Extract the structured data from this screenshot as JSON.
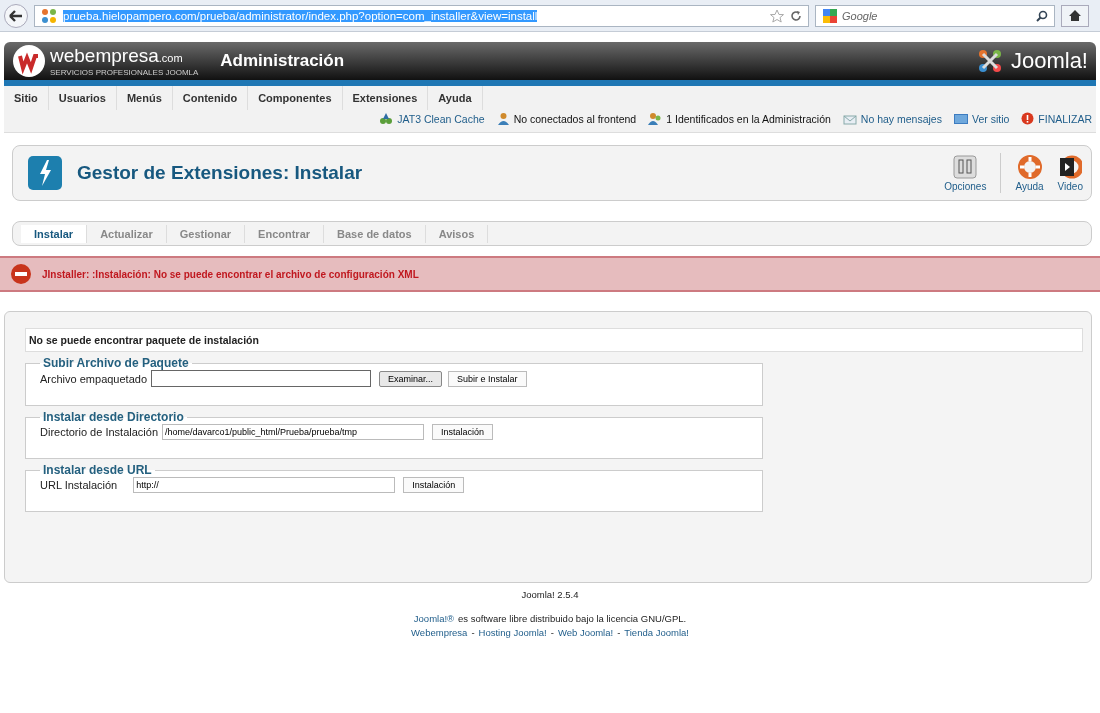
{
  "browser": {
    "url": "prueba.hielopampero.com/prueba/administrator/index.php?option=com_installer&view=install",
    "search_placeholder": "Google"
  },
  "header": {
    "brand": "webempresa",
    "brand_suffix": ".com",
    "tagline": "SERVICIOS PROFESIONALES JOOMLA",
    "title": "Administración",
    "logo": "Joomla!"
  },
  "menu": [
    "Sitio",
    "Usuarios",
    "Menús",
    "Contenido",
    "Componentes",
    "Extensiones",
    "Ayuda"
  ],
  "status": [
    {
      "label": "JAT3 Clean Cache",
      "kind": "cache"
    },
    {
      "label": "No conectados al frontend",
      "kind": "users"
    },
    {
      "label": "1 Identificados en la Administración",
      "kind": "admins"
    },
    {
      "label": "No hay mensajes",
      "kind": "messages"
    },
    {
      "label": "Ver sitio",
      "kind": "site"
    },
    {
      "label": "FINALIZAR",
      "kind": "logout"
    }
  ],
  "toolbar": {
    "title": "Gestor de Extensiones: Instalar",
    "buttons": [
      {
        "label": "Opciones",
        "kind": "options"
      },
      {
        "label": "Ayuda",
        "kind": "help"
      },
      {
        "label": "Video",
        "kind": "video"
      }
    ]
  },
  "subtabs": [
    {
      "label": "Instalar",
      "selected": true
    },
    {
      "label": "Actualizar",
      "selected": false
    },
    {
      "label": "Gestionar",
      "selected": false
    },
    {
      "label": "Encontrar",
      "selected": false
    },
    {
      "label": "Base de datos",
      "selected": false
    },
    {
      "label": "Avisos",
      "selected": false
    }
  ],
  "error": "JInstaller: :Instalación: No se puede encontrar el archivo de configuración XML",
  "notice": "No se puede encontrar paquete de instalación",
  "sections": [
    {
      "legend": "Subir Archivo de Paquete",
      "label": "Archivo empaquetado",
      "kind": "file",
      "buttons": [
        "Examinar...",
        "Subir e Instalar"
      ]
    },
    {
      "legend": "Instalar desde Directorio",
      "label": "Directorio de Instalación",
      "kind": "text",
      "value": "/home/davarco1/public_html/Prueba/prueba/tmp",
      "buttons": [
        "Instalación"
      ]
    },
    {
      "legend": "Instalar desde URL",
      "label": "URL Instalación",
      "kind": "text",
      "value": "http://",
      "buttons": [
        "Instalación"
      ]
    }
  ],
  "footer": {
    "version": "Joomla! 2.5.4",
    "license_link": "Joomla!®",
    "license_text": "es software libre distribuido bajo la licencia GNU/GPL.",
    "links": [
      {
        "text": "Webempresa",
        "kind": "link"
      },
      {
        "text": "-",
        "kind": "sep"
      },
      {
        "text": "Hosting Joomla!",
        "kind": "link"
      },
      {
        "text": "-",
        "kind": "sep"
      },
      {
        "text": "Web Joomla!",
        "kind": "link"
      },
      {
        "text": "-",
        "kind": "sep"
      },
      {
        "text": "Tienda Joomla!",
        "kind": "link"
      }
    ]
  }
}
